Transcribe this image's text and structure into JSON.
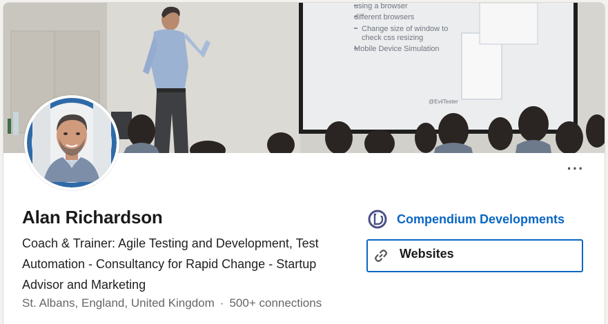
{
  "profile": {
    "name": "Alan Richardson",
    "headline": "Coach & Trainer: Agile Testing and Development, Test Automation - Consultancy for Rapid Change - Startup Advisor and Marketing",
    "location": "St. Albans, England, United Kingdom",
    "separator": "·",
    "connections": "500+ connections"
  },
  "banner": {
    "slide_bullets": [
      "using a browser",
      "different browsers",
      "Change size of window to",
      "check css resizing",
      "Mobile Device Simulation"
    ],
    "slide_handle": "@EvilTester"
  },
  "menu": {
    "more_icon": "more-horizontal-icon"
  },
  "company": {
    "label": "Compendium Developments",
    "logo_icon": "company-logo-icon"
  },
  "websites": {
    "label": "Websites",
    "icon": "link-icon"
  },
  "colors": {
    "accent": "#0a66c2",
    "avatar_ring": "#2f6aa8",
    "text_muted": "#666666"
  }
}
